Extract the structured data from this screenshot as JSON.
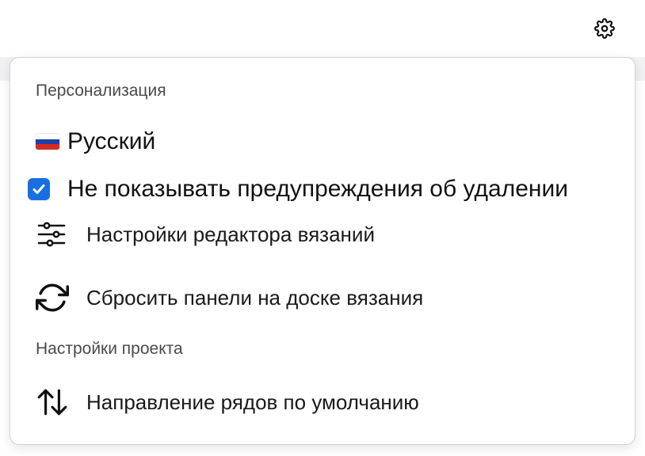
{
  "header": {
    "settings_icon": "gear-icon"
  },
  "menu": {
    "personalization_title": "Персонализация",
    "language": {
      "flag_icon": "russian-flag-icon",
      "label": "Русский"
    },
    "delete_warning": {
      "checked": true,
      "label": "Не показывать предупреждения об удалении"
    },
    "items": [
      {
        "icon": "sliders-icon",
        "label": "Настройки редактора вязаний"
      },
      {
        "icon": "refresh-icon",
        "label": "Сбросить панели на доске вязания"
      }
    ],
    "project_title": "Настройки проекта",
    "project_items": [
      {
        "icon": "sort-arrows-icon",
        "label": "Направление рядов по умолчанию"
      }
    ]
  },
  "colors": {
    "accent": "#1a6fe0",
    "flag_white": "#ffffff",
    "flag_blue": "#1d3fa8",
    "flag_red": "#d52b1e"
  }
}
